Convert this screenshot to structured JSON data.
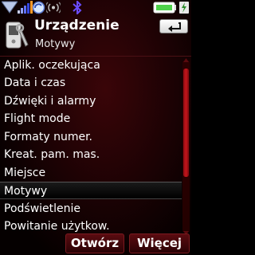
{
  "status_bar": {
    "icons": [
      "signal-strength-icon",
      "network-bars-icon",
      "sync-icon",
      "radio-icon",
      "bluetooth-icon",
      "battery-icon",
      "charging-icon"
    ],
    "battery_color": "#4fd14a"
  },
  "header": {
    "title": "Urządzenie",
    "subtitle": "Motywy",
    "icon": "phone-settings-icon",
    "back_icon": "back-arrow-icon"
  },
  "list": {
    "items": [
      "Aplik. oczekująca",
      "Data i czas",
      "Dźwięki i alarmy",
      "Flight mode",
      "Formaty numer.",
      "Kreat. pam. mas.",
      "Miejsce",
      "Motywy",
      "Podświetlenie",
      "Powitanie użytkow."
    ],
    "selected_index": 7
  },
  "softkeys": {
    "left": "Otwórz",
    "right": "Więcej"
  },
  "colors": {
    "background": "#1c0204",
    "accent": "#c5141b",
    "text": "#ffffff"
  }
}
